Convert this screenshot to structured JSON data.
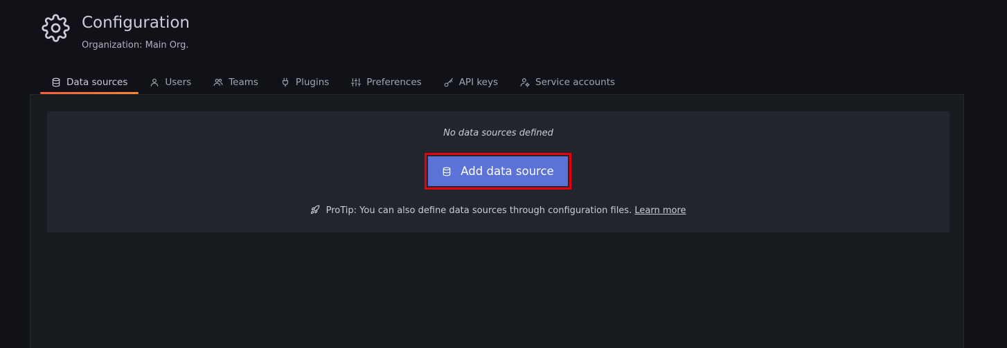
{
  "header": {
    "icon": "gear-icon",
    "title": "Configuration",
    "subtitle": "Organization: Main Org."
  },
  "tabs": [
    {
      "label": "Data sources",
      "icon": "database-icon",
      "active": true
    },
    {
      "label": "Users",
      "icon": "user-icon",
      "active": false
    },
    {
      "label": "Teams",
      "icon": "users-icon",
      "active": false
    },
    {
      "label": "Plugins",
      "icon": "plug-icon",
      "active": false
    },
    {
      "label": "Preferences",
      "icon": "sliders-icon",
      "active": false
    },
    {
      "label": "API keys",
      "icon": "key-icon",
      "active": false
    },
    {
      "label": "Service accounts",
      "icon": "user-cog-icon",
      "active": false
    }
  ],
  "empty_state": {
    "title": "No data sources defined",
    "button_label": "Add data source",
    "button_icon": "database-icon",
    "protip_icon": "rocket-icon",
    "protip_text": "ProTip: You can also define data sources through configuration files.",
    "protip_link": "Learn more"
  },
  "colors": {
    "background": "#111217",
    "panel": "#181b1f",
    "card": "#22252b",
    "primary_button": "#5b73d6",
    "highlight_border": "#e8000f",
    "active_tab_underline": "#f55f3e"
  }
}
